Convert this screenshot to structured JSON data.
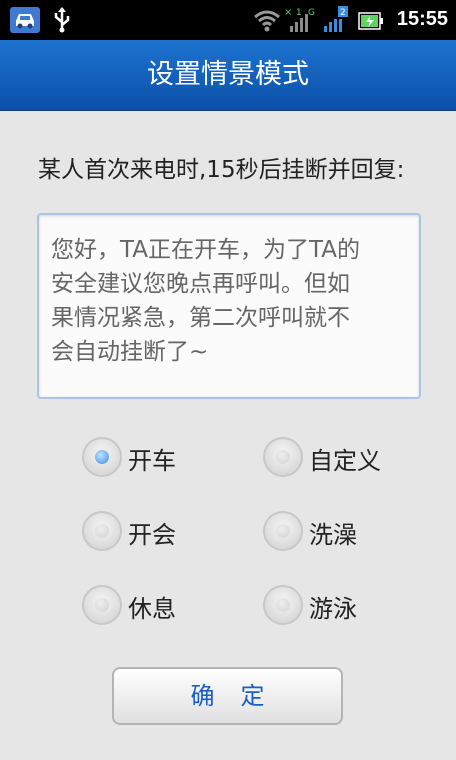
{
  "statusbar": {
    "time": "15:55",
    "icons": [
      "car-app-icon",
      "usb-icon",
      "wifi-icon",
      "signal-icon",
      "signal-2-icon",
      "battery-icon"
    ],
    "signal_badges": [
      "1",
      "G",
      "2"
    ]
  },
  "header": {
    "title": "设置情景模式"
  },
  "prompt": "某人首次来电时,15秒后挂断并回复:",
  "message": "您好，TA正在开车，为了TA的\n安全建议您晚点再呼叫。但如\n果情况紧急，第二次呼叫就不\n会自动挂断了~",
  "modes": [
    {
      "label": "开车",
      "selected": true
    },
    {
      "label": "自定义",
      "selected": false
    },
    {
      "label": "开会",
      "selected": false
    },
    {
      "label": "洗澡",
      "selected": false
    },
    {
      "label": "休息",
      "selected": false
    },
    {
      "label": "游泳",
      "selected": false
    }
  ],
  "confirm_label": "确定",
  "colors": {
    "accent": "#1d74cf",
    "button_text": "#1a5ec8",
    "selected_dot": "#3a8de0"
  }
}
